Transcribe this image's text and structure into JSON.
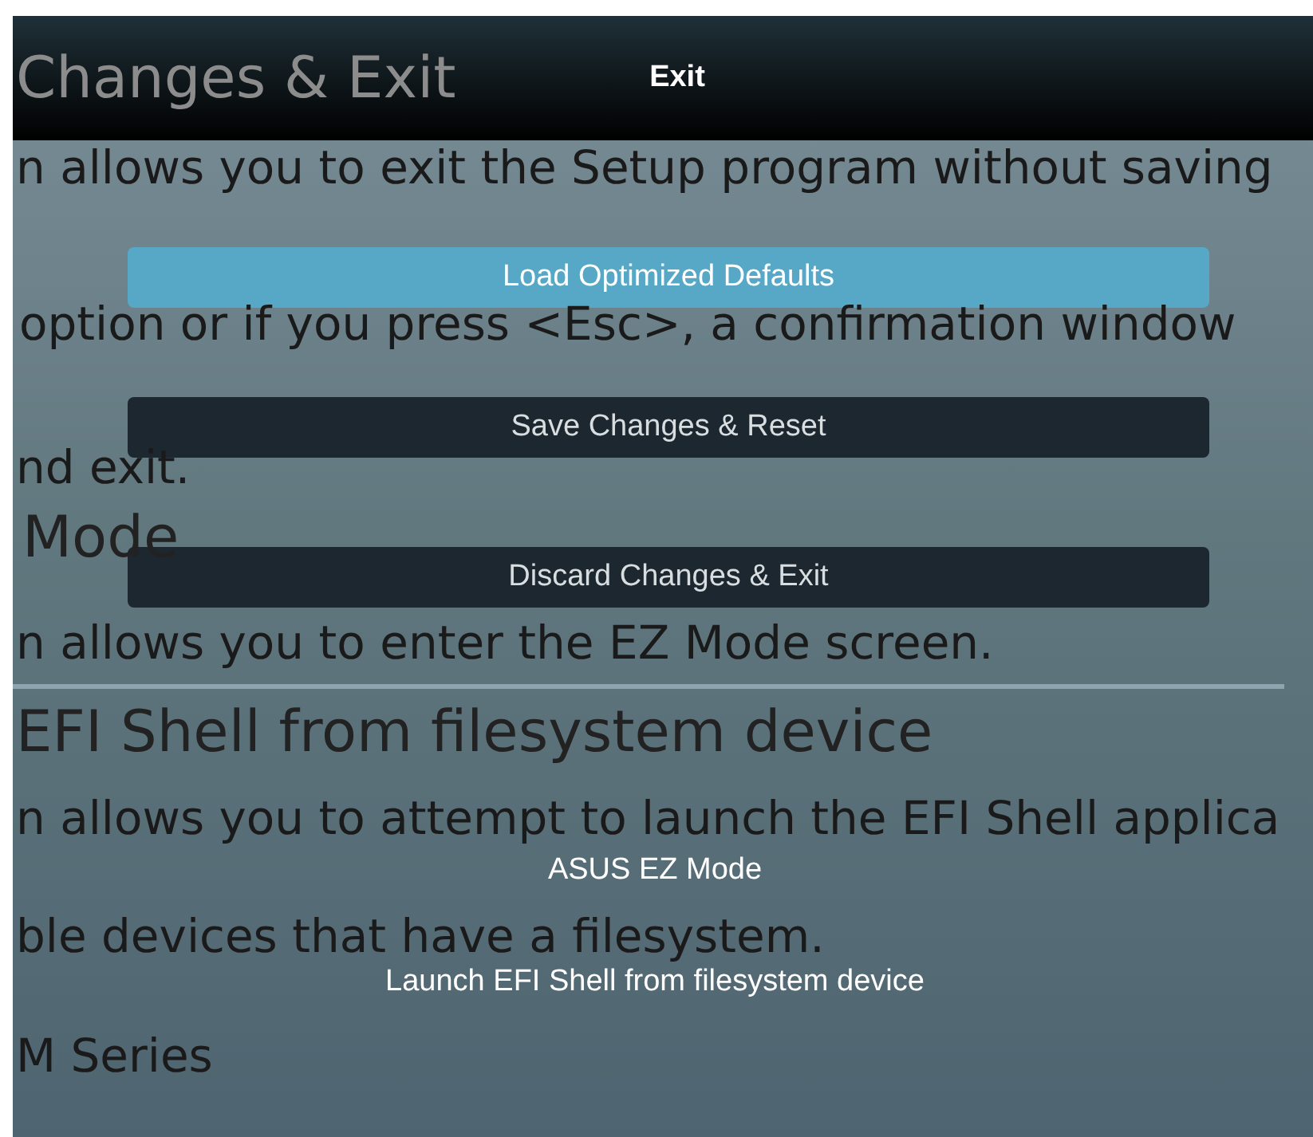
{
  "dialog": {
    "title": "Exit",
    "buttons": [
      {
        "label": "Load Optimized Defaults",
        "selected": true
      },
      {
        "label": "Save Changes & Reset",
        "selected": false
      },
      {
        "label": "Discard Changes & Exit",
        "selected": false
      }
    ],
    "items": [
      "ASUS EZ Mode",
      "Launch EFI Shell from filesystem device"
    ]
  },
  "overlay_text": [
    {
      "kind": "heading",
      "text": "Changes & Exit"
    },
    {
      "kind": "body",
      "text": "n allows you to exit the Setup program without saving"
    },
    {
      "kind": "body",
      "text": "option or if you press <Esc>, a confirmation window"
    },
    {
      "kind": "body",
      "text": "nd exit."
    },
    {
      "kind": "heading",
      "text": "Mode"
    },
    {
      "kind": "body",
      "text": "n allows you to enter the EZ Mode screen."
    },
    {
      "kind": "heading",
      "text": "EFI Shell from filesystem device"
    },
    {
      "kind": "body",
      "text": "n allows you to attempt to launch the EFI Shell applica"
    },
    {
      "kind": "body",
      "text": "ble devices that have a filesystem."
    },
    {
      "kind": "body",
      "text": "M Series"
    }
  ]
}
